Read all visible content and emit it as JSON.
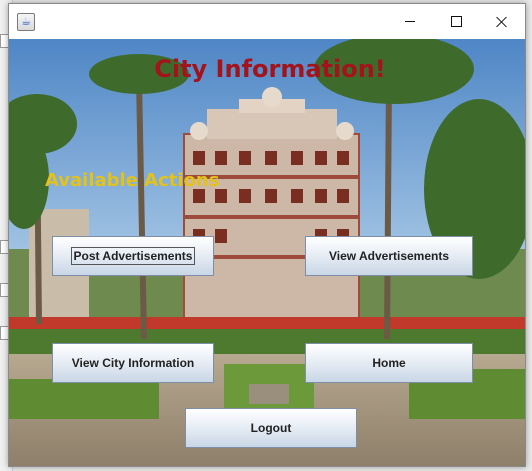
{
  "window": {
    "icon": "java-cup-icon"
  },
  "title_bar_controls": [
    "minimize-icon",
    "maximize-icon",
    "close-icon"
  ],
  "page": {
    "title": "City Information!",
    "subtitle": "Available Actions"
  },
  "actions": {
    "post_ads": "Post Advertisements",
    "view_ads": "View Advertisements",
    "view_city": "View City Information",
    "home": "Home",
    "logout": "Logout"
  },
  "colors": {
    "title": "#a3131b",
    "subtitle": "#e3c21a",
    "button_top": "#ffffff",
    "button_bottom": "#c9d6e6"
  }
}
